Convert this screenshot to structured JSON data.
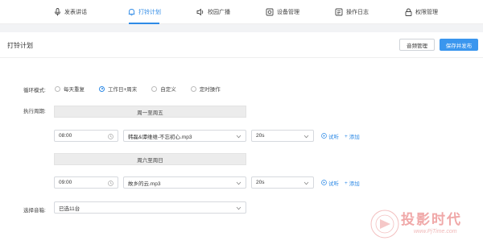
{
  "nav": {
    "items": [
      {
        "label": "发表讲话",
        "icon": "microphone-icon"
      },
      {
        "label": "打铃计划",
        "icon": "bell-icon",
        "active": true
      },
      {
        "label": "校园广播",
        "icon": "speaker-icon"
      },
      {
        "label": "设备管理",
        "icon": "device-icon"
      },
      {
        "label": "操作日志",
        "icon": "log-icon"
      },
      {
        "label": "权限管理",
        "icon": "lock-icon"
      }
    ]
  },
  "header": {
    "title": "打铃计划",
    "audio_button": "音频管理",
    "save_button": "保存并发布"
  },
  "form": {
    "loop_mode_label": "循环模式:",
    "loop_options": [
      "每天重复",
      "工作日+周末",
      "自定义",
      "定时操作"
    ],
    "loop_selected": "工作日+周末",
    "period_label": "执行周期:",
    "schedules": [
      {
        "period": "周一至周五",
        "time": "08:00",
        "audio": "韩磊&谭维维-不忘初心.mp3",
        "duration": "20s",
        "listen": "试听",
        "add": "添加"
      },
      {
        "period": "周六至周日",
        "time": "09:00",
        "audio": "故乡的云.mp3",
        "duration": "20s",
        "listen": "试听",
        "add": "添加"
      }
    ],
    "speaker_label": "选择音箱:",
    "speaker_value": "已选11台"
  },
  "watermark": {
    "text": "投影时代",
    "url": "www.PjTime.com"
  },
  "colors": {
    "accent": "#2e8ae6",
    "primary_button": "#3a96ee",
    "band": "#f2f3f5",
    "watermark": "#f0a8a8"
  }
}
